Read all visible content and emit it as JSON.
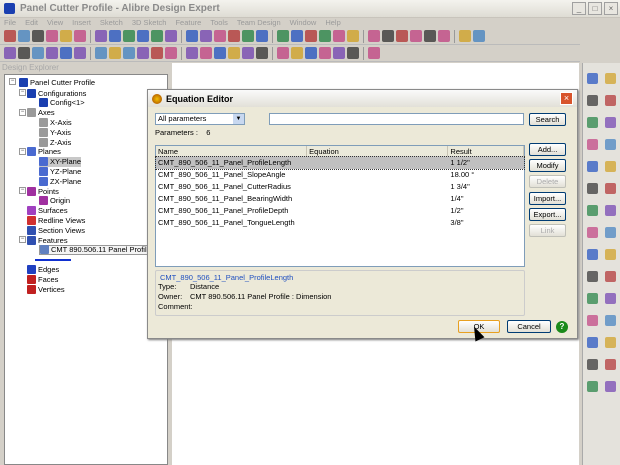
{
  "window": {
    "title": "Panel Cutter Profile - Alibre Design Expert",
    "controls": [
      "_",
      "□",
      "×"
    ]
  },
  "menu": [
    "File",
    "Edit",
    "View",
    "Insert",
    "Sketch",
    "3D Sketch",
    "Feature",
    "Tools",
    "Team Design",
    "Window",
    "Help"
  ],
  "toolbar1": [
    "new",
    "open",
    "save",
    "print-preview",
    "print",
    "publish",
    "pdf",
    "cut",
    "copy",
    "paste",
    "delete",
    "undo",
    "redo",
    "render",
    "display-mode",
    "rotate",
    "zoom",
    "plane",
    "sketch",
    "extrude",
    "revolve",
    "sweep",
    "loft",
    "hole",
    "fillet",
    "chamfer",
    "shell",
    "draft",
    "mirror",
    "pattern",
    "measure",
    "properties"
  ],
  "toolbar2": [
    "point",
    "ellipse",
    "rectangle",
    "text",
    "fill",
    "layers",
    "plane",
    "axis",
    "point3d",
    "constraint",
    "table",
    "parts",
    "dimension",
    "balance",
    "select",
    "move",
    "orbit",
    "zoom-in",
    "zoom-fit",
    "zoom-out",
    "back",
    "forward",
    "pan",
    "ruler",
    "render"
  ],
  "explorer": {
    "label": "Design Explorer",
    "root": "Panel Cutter Profile",
    "items": [
      {
        "label": "Configurations",
        "level": 1,
        "icon": "configurations-icon",
        "color": "#1a3fb0"
      },
      {
        "label": "Config<1>",
        "level": 2,
        "icon": "config-icon",
        "color": "#1a3fb0"
      },
      {
        "label": "Axes",
        "level": 1,
        "icon": "axes-icon",
        "color": "#9a9a9a"
      },
      {
        "label": "X-Axis",
        "level": 2,
        "icon": "axis-icon",
        "color": "#9a9a9a"
      },
      {
        "label": "Y-Axis",
        "level": 2,
        "icon": "axis-icon",
        "color": "#9a9a9a"
      },
      {
        "label": "Z-Axis",
        "level": 2,
        "icon": "axis-icon",
        "color": "#9a9a9a"
      },
      {
        "label": "Planes",
        "level": 1,
        "icon": "planes-icon",
        "color": "#4a6ad0"
      },
      {
        "label": "XY-Plane",
        "level": 2,
        "icon": "plane-icon",
        "color": "#4a6ad0"
      },
      {
        "label": "YZ-Plane",
        "level": 2,
        "icon": "plane-icon",
        "color": "#4a6ad0"
      },
      {
        "label": "ZX-Plane",
        "level": 2,
        "icon": "plane-icon",
        "color": "#4a6ad0"
      },
      {
        "label": "Points",
        "level": 1,
        "icon": "points-icon",
        "color": "#a030a0"
      },
      {
        "label": "Origin",
        "level": 2,
        "icon": "origin-icon",
        "color": "#a030a0"
      },
      {
        "label": "Surfaces",
        "level": 1,
        "icon": "surfaces-icon",
        "color": "#a040c0"
      },
      {
        "label": "Redline Views",
        "level": 1,
        "icon": "redline-icon",
        "color": "#d03030"
      },
      {
        "label": "Section Views",
        "level": 1,
        "icon": "section-icon",
        "color": "#3050b0"
      },
      {
        "label": "Features",
        "level": 1,
        "icon": "features-icon",
        "color": "#3050b0"
      },
      {
        "label": "CMT 890.506.11 Panel Profile",
        "level": 2,
        "icon": "feature-icon",
        "color": "#6080c0"
      },
      {
        "label": "",
        "level": 2,
        "icon": "spacer",
        "color": "#fff"
      },
      {
        "label": "Edges",
        "level": 1,
        "icon": "edges-icon",
        "color": "#2040c0"
      },
      {
        "label": "Faces",
        "level": 1,
        "icon": "faces-icon",
        "color": "#c02020"
      },
      {
        "label": "Vertices",
        "level": 1,
        "icon": "vertices-icon",
        "color": "#c02020"
      }
    ]
  },
  "dialog": {
    "title": "Equation Editor",
    "filter": "All parameters",
    "search_value": "",
    "search_button": "Search",
    "params_label": "Parameters :",
    "params_count": "6",
    "columns": [
      "Name",
      "Equation",
      "Result"
    ],
    "rows": [
      {
        "name": "CMT_890_506_11_Panel_ProfileLength",
        "equation": "",
        "result": "1 1/2\""
      },
      {
        "name": "CMT_890_506_11_Panel_SlopeAngle",
        "equation": "",
        "result": "18.00 °"
      },
      {
        "name": "CMT_890_506_11_Panel_CutterRadius",
        "equation": "",
        "result": "1 3/4\""
      },
      {
        "name": "CMT_890_506_11_Panel_BearingWidth",
        "equation": "",
        "result": "1/4\""
      },
      {
        "name": "CMT_890_506_11_Panel_ProfileDepth",
        "equation": "",
        "result": "1/2\""
      },
      {
        "name": "CMT_890_506_11_Panel_TongueLength",
        "equation": "",
        "result": "3/8\""
      }
    ],
    "buttons": {
      "add": "Add...",
      "modify": "Modify",
      "delete": "Delete",
      "import": "Import...",
      "export": "Export...",
      "link": "Link"
    },
    "info": {
      "header": "CMT_890_506_11_Panel_ProfileLength",
      "type_label": "Type:",
      "type": "Distance",
      "owner_label": "Owner:",
      "owner": "CMT 890.506.11 Panel Profile : Dimension",
      "comment_label": "Comment:",
      "comment": ""
    },
    "ok": "OK",
    "cancel": "Cancel",
    "help": "?"
  }
}
